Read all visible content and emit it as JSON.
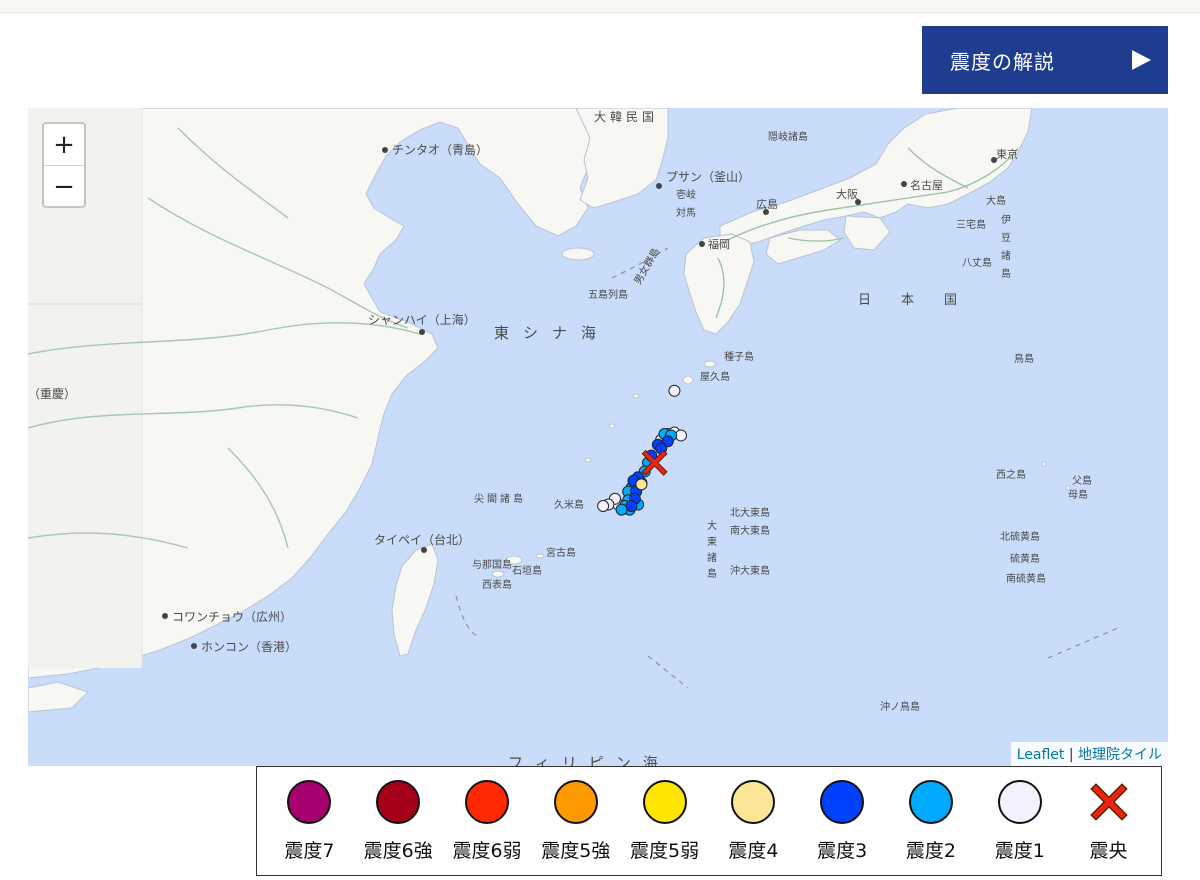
{
  "header": {
    "explain_label": "震度の解説"
  },
  "map": {
    "zoom_in": "+",
    "zoom_out": "−",
    "attribution": {
      "leaflet": "Leaflet",
      "separator": "|",
      "tiles": "地理院タイル"
    },
    "labels": {
      "korea": "大韓民国",
      "qingdao": "チンタオ（青島）",
      "busan": "プサン（釜山）",
      "shanghai": "シャンハイ（上海）",
      "east_china_sea": "東シナ海",
      "chongqing": "（重慶）",
      "taipei": "タイペイ（台北）",
      "guangzhou": "コワンチョウ（広州）",
      "hongkong": "ホンコン（香港）",
      "japan": "日本国",
      "tokyo": "東京",
      "nagoya": "名古屋",
      "osaka": "大阪",
      "hiroshima": "広島",
      "fukuoka": "福岡",
      "tanegashima": "種子島",
      "yakushima": "屋久島",
      "oki": "隠岐諸島",
      "tsushima": "対馬",
      "iki": "壱岐",
      "goto": "五島列島",
      "danjo": "男女群島",
      "senkaku": "尖閣諸島",
      "kume": "久米島",
      "miyako": "宮古島",
      "ishigaki": "石垣島",
      "yonaguni": "与那国島",
      "iriomote": "西表島",
      "kitadaito": "北大東島",
      "minamidaito": "南大東島",
      "okidaito": "沖大東島",
      "daito_islands": "大東諸島",
      "izu_oshima": "大島",
      "miyakejima": "三宅島",
      "hachijojima": "八丈島",
      "izu_islands": "伊豆諸島",
      "torishima": "鳥島",
      "nishinoshima": "西之島",
      "chichijima": "父島",
      "hahajima": "母島",
      "kitaiwo": "北硫黄島",
      "iwo": "硫黄島",
      "minamiiwo": "南硫黄島",
      "okinotori": "沖ノ鳥島",
      "philippine_sea": "フィリピン海"
    }
  },
  "quake": {
    "epicenter": {
      "lon": 129.3,
      "lat": 28.1
    },
    "intensity_points": [
      {
        "lon": 129.6,
        "lat": 29.1,
        "level": "1"
      },
      {
        "lon": 129.5,
        "lat": 28.5,
        "level": "1"
      },
      {
        "lon": 129.6,
        "lat": 28.52,
        "level": "1"
      },
      {
        "lon": 129.7,
        "lat": 28.48,
        "level": "1"
      },
      {
        "lon": 129.4,
        "lat": 28.42,
        "level": "1"
      },
      {
        "lon": 129.45,
        "lat": 28.5,
        "level": "2"
      },
      {
        "lon": 129.55,
        "lat": 28.48,
        "level": "2"
      },
      {
        "lon": 129.5,
        "lat": 28.4,
        "level": "3"
      },
      {
        "lon": 129.35,
        "lat": 28.35,
        "level": "3"
      },
      {
        "lon": 129.4,
        "lat": 28.3,
        "level": "3"
      },
      {
        "lon": 129.25,
        "lat": 28.2,
        "level": "3"
      },
      {
        "lon": 129.2,
        "lat": 28.1,
        "level": "2"
      },
      {
        "lon": 129.15,
        "lat": 27.98,
        "level": "2"
      },
      {
        "lon": 129.05,
        "lat": 27.9,
        "level": "3"
      },
      {
        "lon": 129.1,
        "lat": 27.82,
        "level": "2"
      },
      {
        "lon": 128.98,
        "lat": 27.85,
        "level": "3"
      },
      {
        "lon": 128.95,
        "lat": 27.75,
        "level": "2"
      },
      {
        "lon": 129.02,
        "lat": 27.7,
        "level": "3"
      },
      {
        "lon": 128.9,
        "lat": 27.7,
        "level": "2"
      },
      {
        "lon": 129.0,
        "lat": 27.6,
        "level": "3"
      },
      {
        "lon": 128.9,
        "lat": 27.58,
        "level": "2"
      },
      {
        "lon": 128.95,
        "lat": 27.5,
        "level": "3"
      },
      {
        "lon": 128.85,
        "lat": 27.5,
        "level": "2"
      },
      {
        "lon": 129.05,
        "lat": 27.52,
        "level": "2"
      },
      {
        "lon": 128.92,
        "lat": 27.45,
        "level": "2"
      },
      {
        "lon": 128.8,
        "lat": 27.45,
        "level": "2"
      },
      {
        "lon": 128.75,
        "lat": 27.52,
        "level": "1"
      },
      {
        "lon": 128.7,
        "lat": 27.6,
        "level": "1"
      },
      {
        "lon": 128.6,
        "lat": 27.52,
        "level": "1"
      },
      {
        "lon": 128.52,
        "lat": 27.5,
        "level": "1"
      },
      {
        "lon": 129.1,
        "lat": 27.8,
        "level": "4"
      }
    ]
  },
  "legend": {
    "items": [
      {
        "label": "震度7",
        "color": "#a8006e"
      },
      {
        "label": "震度6強",
        "color": "#a4001a"
      },
      {
        "label": "震度6弱",
        "color": "#ff2800"
      },
      {
        "label": "震度5強",
        "color": "#ff9900"
      },
      {
        "label": "震度5弱",
        "color": "#ffe600"
      },
      {
        "label": "震度4",
        "color": "#fae696"
      },
      {
        "label": "震度3",
        "color": "#0041ff"
      },
      {
        "label": "震度2",
        "color": "#00aaff"
      },
      {
        "label": "震度1",
        "color": "#f2f2ff"
      }
    ],
    "epicenter_label": "震央",
    "epicenter_color": "#e8250e"
  }
}
